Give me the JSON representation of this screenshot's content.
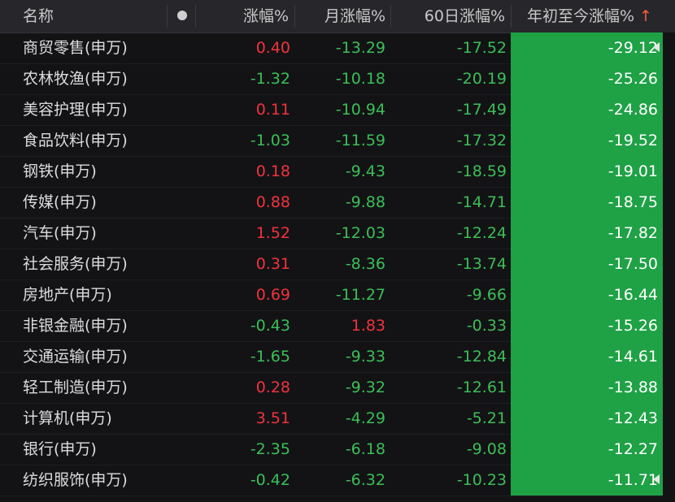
{
  "header": {
    "name": "名称",
    "change": "涨幅%",
    "month": "月涨幅%",
    "d60": "60日涨幅%",
    "ytd": "年初至今涨幅%",
    "sort_arrow": "↑"
  },
  "colors": {
    "up": "#f0333b",
    "down": "#3bbf55",
    "highlight": "#1fa146"
  },
  "rows": [
    {
      "name": "商贸零售(申万)",
      "chg": "0.40",
      "mon": "-13.29",
      "d60": "-17.52",
      "ytd": "-29.12"
    },
    {
      "name": "农林牧渔(申万)",
      "chg": "-1.32",
      "mon": "-10.18",
      "d60": "-20.19",
      "ytd": "-25.26"
    },
    {
      "name": "美容护理(申万)",
      "chg": "0.11",
      "mon": "-10.94",
      "d60": "-17.49",
      "ytd": "-24.86"
    },
    {
      "name": "食品饮料(申万)",
      "chg": "-1.03",
      "mon": "-11.59",
      "d60": "-17.32",
      "ytd": "-19.52"
    },
    {
      "name": "钢铁(申万)",
      "chg": "0.18",
      "mon": "-9.43",
      "d60": "-18.59",
      "ytd": "-19.01"
    },
    {
      "name": "传媒(申万)",
      "chg": "0.88",
      "mon": "-9.88",
      "d60": "-14.71",
      "ytd": "-18.75"
    },
    {
      "name": "汽车(申万)",
      "chg": "1.52",
      "mon": "-12.03",
      "d60": "-12.24",
      "ytd": "-17.82"
    },
    {
      "name": "社会服务(申万)",
      "chg": "0.31",
      "mon": "-8.36",
      "d60": "-13.74",
      "ytd": "-17.50"
    },
    {
      "name": "房地产(申万)",
      "chg": "0.69",
      "mon": "-11.27",
      "d60": "-9.66",
      "ytd": "-16.44"
    },
    {
      "name": "非银金融(申万)",
      "chg": "-0.43",
      "mon": "1.83",
      "d60": "-0.33",
      "ytd": "-15.26"
    },
    {
      "name": "交通运输(申万)",
      "chg": "-1.65",
      "mon": "-9.33",
      "d60": "-12.84",
      "ytd": "-14.61"
    },
    {
      "name": "轻工制造(申万)",
      "chg": "0.28",
      "mon": "-9.32",
      "d60": "-12.61",
      "ytd": "-13.88"
    },
    {
      "name": "计算机(申万)",
      "chg": "3.51",
      "mon": "-4.29",
      "d60": "-5.21",
      "ytd": "-12.43"
    },
    {
      "name": "银行(申万)",
      "chg": "-2.35",
      "mon": "-6.18",
      "d60": "-9.08",
      "ytd": "-12.27"
    },
    {
      "name": "纺织服饰(申万)",
      "chg": "-0.42",
      "mon": "-6.32",
      "d60": "-10.23",
      "ytd": "-11.71"
    }
  ]
}
